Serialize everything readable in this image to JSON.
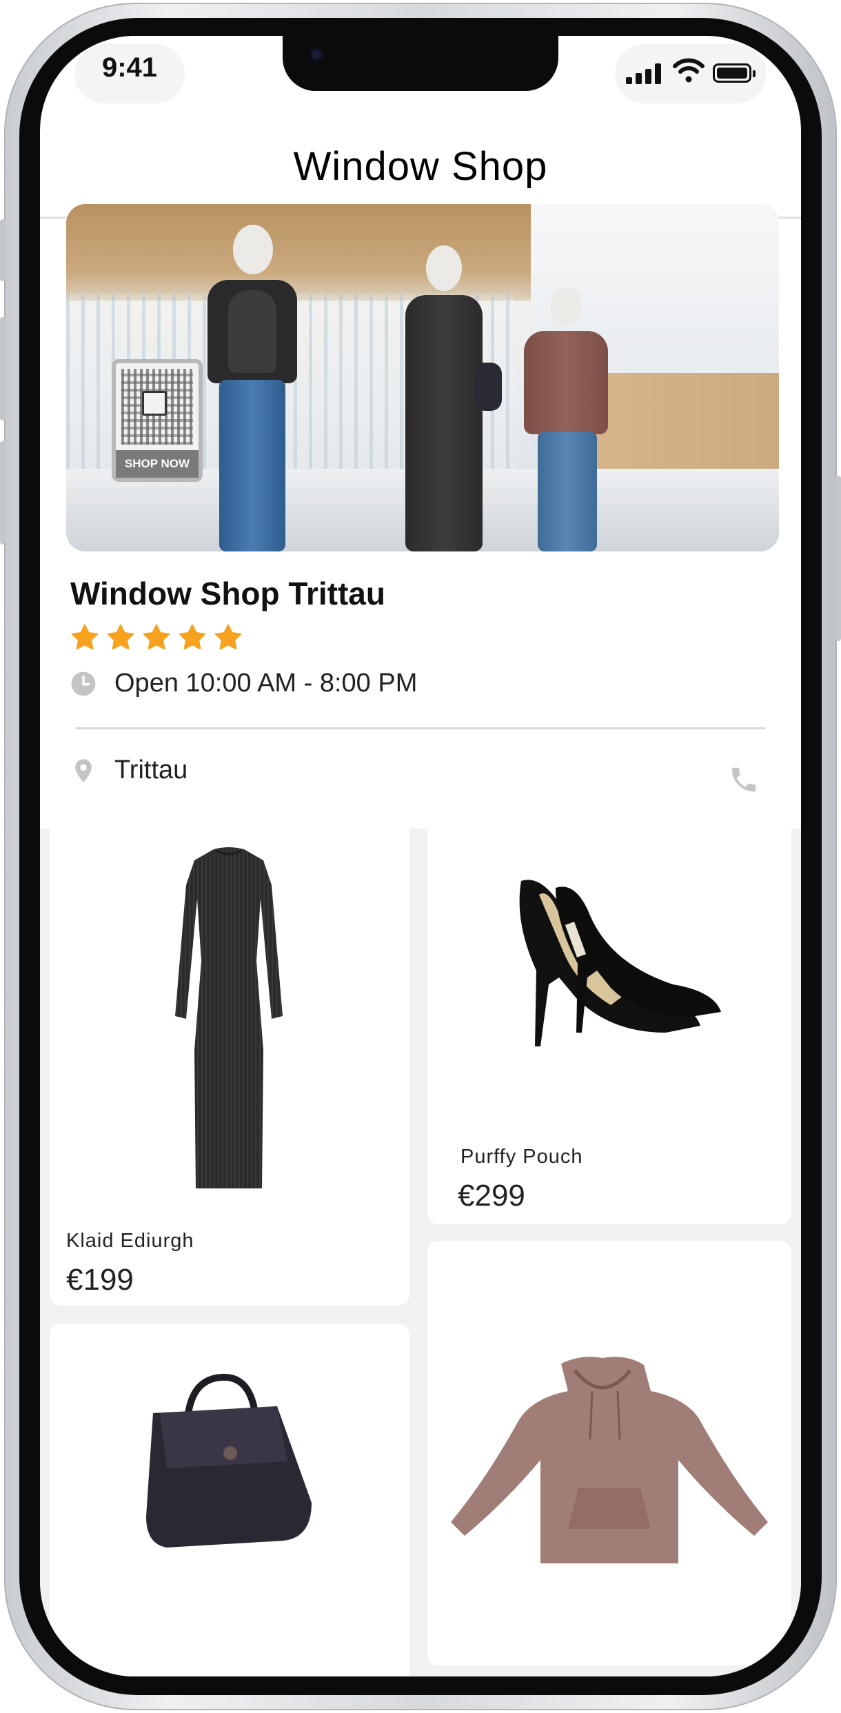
{
  "status": {
    "time": "9:41"
  },
  "header": {
    "title": "Window Shop"
  },
  "hero": {
    "sign_label": "SHOP NOW"
  },
  "store": {
    "name": "Window Shop Trittau",
    "rating": 5,
    "rating_max": 5,
    "hours": "Open 10:00 AM - 8:00 PM",
    "location": "Trittau"
  },
  "products": [
    {
      "name": "Klaid Ediurgh",
      "price": "€199",
      "image": "dress"
    },
    {
      "name": "Purffy Pouch",
      "price": "€299",
      "image": "heels"
    },
    {
      "name": "",
      "price": "",
      "image": "handbag"
    },
    {
      "name": "",
      "price": "",
      "image": "hoodie"
    }
  ],
  "colors": {
    "star": "#F6A21E",
    "icon_gray": "#c4c4c4",
    "background_gray": "#f1f1f1"
  }
}
